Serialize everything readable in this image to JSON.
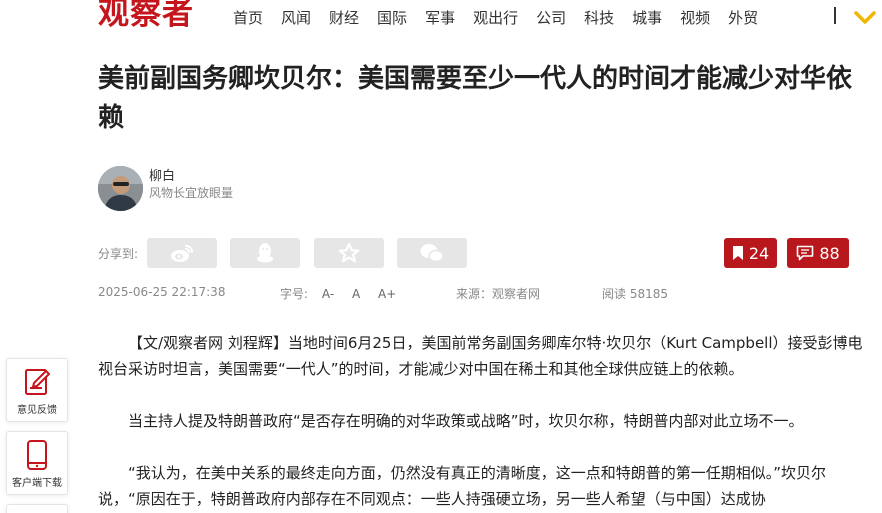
{
  "site": {
    "logo_text": "观察者"
  },
  "nav": {
    "items": [
      {
        "label": "首页"
      },
      {
        "label": "风闻"
      },
      {
        "label": "财经"
      },
      {
        "label": "国际"
      },
      {
        "label": "军事"
      },
      {
        "label": "观出行"
      },
      {
        "label": "公司"
      },
      {
        "label": "科技"
      },
      {
        "label": "城事"
      },
      {
        "label": "视频"
      },
      {
        "label": "外贸"
      }
    ],
    "more_icon": "chevron-down-icon"
  },
  "article": {
    "title": "美前副国务卿坎贝尔：美国需要至少一代人的时间才能减少对华依赖",
    "author": {
      "name": "柳白",
      "bio": "风物长宜放眼量"
    },
    "share_label": "分享到:",
    "share_icons": [
      "weibo-icon",
      "qq-icon",
      "favorite-star-icon",
      "wechat-icon"
    ],
    "bookmark_count": "24",
    "comment_count": "88",
    "datetime": "2025-06-25 22:17:38",
    "font_size_label": "字号:",
    "font_size_options": [
      "A-",
      "A",
      "A+"
    ],
    "source": "来源：观察者网",
    "reads": "阅读 58185",
    "paragraphs": [
      "【文/观察者网 刘程辉】当地时间6月25日，美国前常务副国务卿库尔特·坎贝尔（Kurt Campbell）接受彭博电视台采访时坦言，美国需要“一代人”的时间，才能减少对中国在稀土和其他全球供应链上的依赖。",
      "当主持人提及特朗普政府“是否存在明确的对华政策或战略”时，坎贝尔称，特朗普内部对此立场不一。",
      "“我认为，在美中关系的最终走向方面，仍然没有真正的清晰度，这一点和特朗普的第一任期相似。”坎贝尔说，“原因在于，特朗普政府内部存在不同观点：一些人持强硬立场，另一些人希望（与中国）达成协"
    ]
  },
  "side_panel": {
    "feedback_label": "意见反馈",
    "app_label": "客户端下载"
  },
  "colors": {
    "brand": "#c4161c",
    "button_red": "#b8171c",
    "share_bg": "#e6e6e6",
    "accent_yellow": "#f2b600"
  }
}
